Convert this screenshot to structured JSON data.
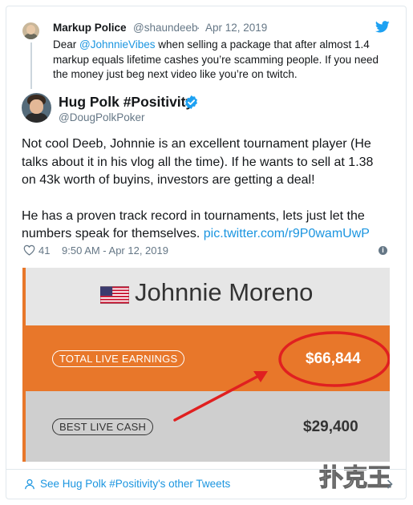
{
  "reply_tweet": {
    "name": "Markup Police",
    "handle": "@shaundeeb",
    "separator": "·",
    "date": "Apr 12, 2019",
    "text_before": "Dear ",
    "mention": "@JohnnieVibes",
    "text_after": " when selling a package that after almost 1.4 markup  equals lifetime cashes you’re  scamming people. If you need the money just beg next video like you’re on twitch."
  },
  "main_tweet": {
    "name": "Hug Polk #Positivity",
    "handle": "@DougPolkPoker",
    "paragraph1": "Not cool Deeb, Johnnie is an excellent tournament player (He talks about it in his vlog all the time). If he wants to sell at 1.38 on 43k worth of buyins, investors are getting a deal!",
    "paragraph2_text": "He has a proven track record in tournaments, lets just let the numbers speak for themselves. ",
    "paragraph2_link": "pic.twitter.com/r9P0wamUwP",
    "likes": "41",
    "timestamp": "9:50 AM - Apr 12, 2019",
    "info_glyph": "i"
  },
  "photo": {
    "player_name": "Johnnie Moreno",
    "total_label": "TOTAL LIVE EARNINGS",
    "total_value": "$66,844",
    "best_label": "BEST LIVE CASH",
    "best_value": "$29,400",
    "annotation_color": "#e02020",
    "flag": "us-flag-icon"
  },
  "footer": {
    "link_text": "See Hug Polk #Positivity's other Tweets"
  },
  "watermark": {
    "text": "扑克王"
  },
  "colors": {
    "link": "#1b95e0",
    "muted": "#657786",
    "orange": "#e8772a",
    "gray_band": "#cfcfcf",
    "verified": "#1da1f2"
  }
}
